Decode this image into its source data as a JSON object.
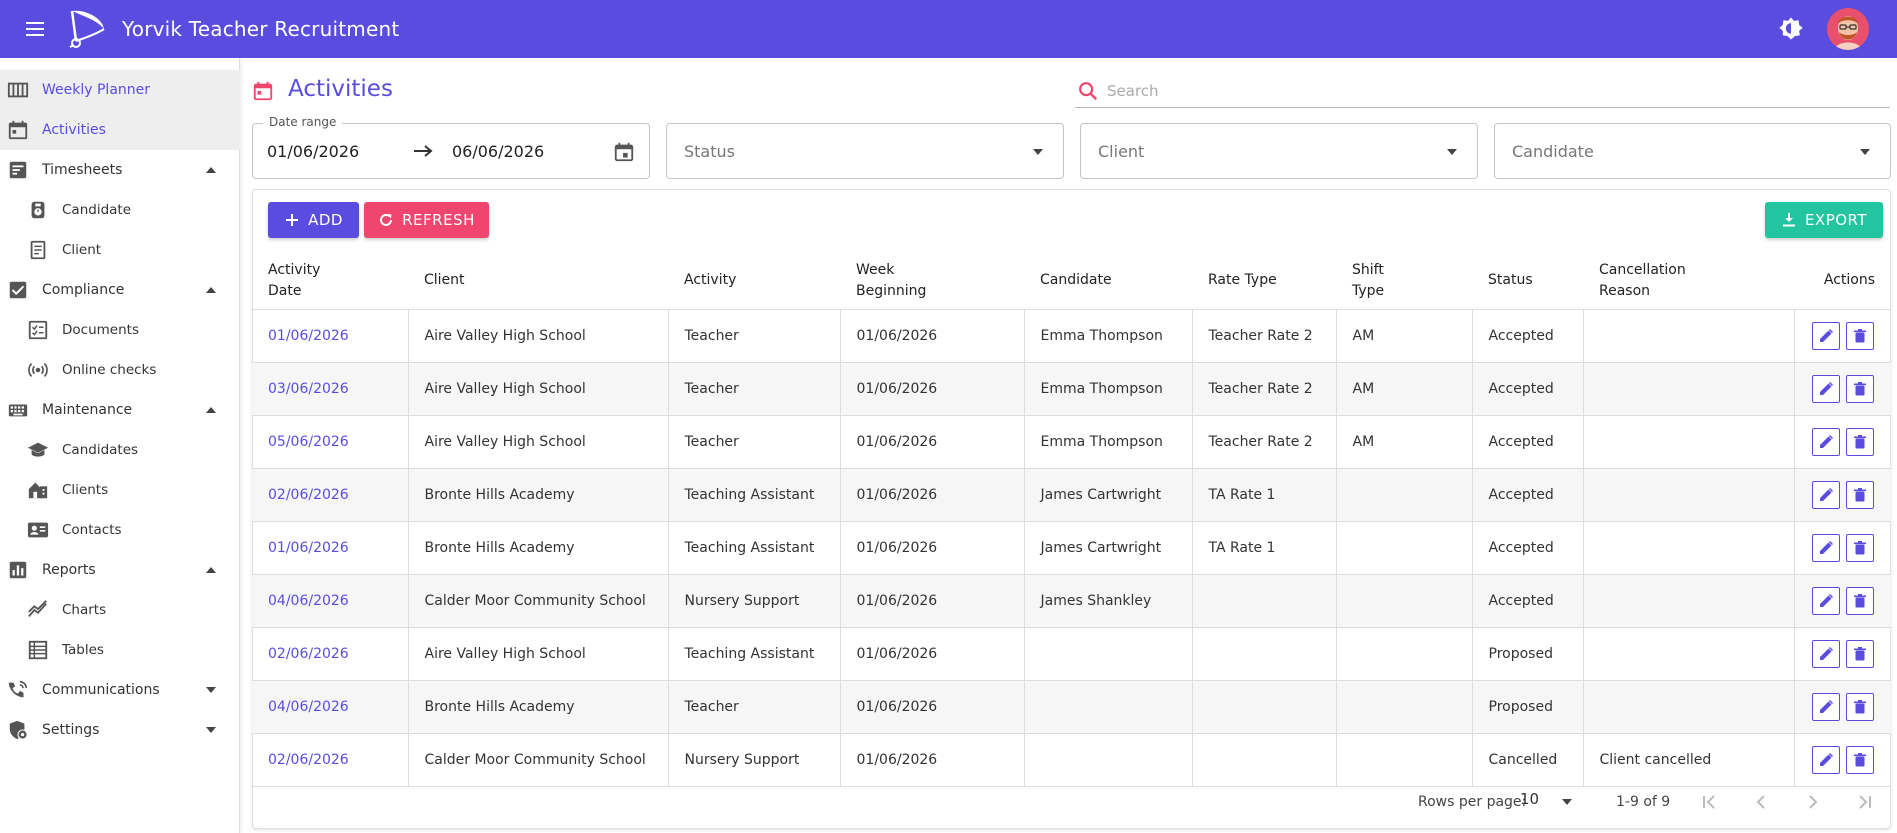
{
  "header": {
    "title": "Yorvik Teacher Recruitment"
  },
  "sidebar": {
    "items": [
      {
        "label": "Weekly Planner",
        "icon": "calendar-week-icon"
      },
      {
        "label": "Activities",
        "icon": "calendar-icon"
      },
      {
        "label": "Timesheets",
        "icon": "timesheet-icon"
      },
      {
        "label": "Candidate",
        "icon": "stopwatch-icon"
      },
      {
        "label": "Client",
        "icon": "book-icon"
      },
      {
        "label": "Compliance",
        "icon": "checkbox-icon"
      },
      {
        "label": "Documents",
        "icon": "checklist-icon"
      },
      {
        "label": "Online checks",
        "icon": "broadcast-icon"
      },
      {
        "label": "Maintenance",
        "icon": "keyboard-icon"
      },
      {
        "label": "Candidates",
        "icon": "graduation-cap-icon"
      },
      {
        "label": "Clients",
        "icon": "building-icon"
      },
      {
        "label": "Contacts",
        "icon": "contact-card-icon"
      },
      {
        "label": "Reports",
        "icon": "bar-chart-icon"
      },
      {
        "label": "Charts",
        "icon": "line-chart-icon"
      },
      {
        "label": "Tables",
        "icon": "table-icon"
      },
      {
        "label": "Communications",
        "icon": "communications-icon"
      },
      {
        "label": "Settings",
        "icon": "shield-gear-icon"
      }
    ]
  },
  "page": {
    "title": "Activities"
  },
  "search": {
    "placeholder": "Search"
  },
  "filters": {
    "date_range_label": "Date range",
    "date_from": "01/06/2026",
    "date_to": "06/06/2026",
    "status_placeholder": "Status",
    "client_placeholder": "Client",
    "candidate_placeholder": "Candidate"
  },
  "toolbar": {
    "add_label": "ADD",
    "refresh_label": "REFRESH",
    "export_label": "EXPORT"
  },
  "table": {
    "headers": {
      "activity_date_1": "Activity",
      "activity_date_2": "Date",
      "client": "Client",
      "activity": "Activity",
      "week_1": "Week",
      "week_2": "Beginning",
      "candidate": "Candidate",
      "rate_type": "Rate Type",
      "shift_1": "Shift",
      "shift_2": "Type",
      "status": "Status",
      "cancel_1": "Cancellation",
      "cancel_2": "Reason",
      "actions": "Actions"
    },
    "rows": [
      {
        "date": "01/06/2026",
        "client": "Aire Valley High School",
        "activity": "Teacher",
        "week": "01/06/2026",
        "candidate": "Emma Thompson",
        "rate": "Teacher Rate 2",
        "shift": "AM",
        "status": "Accepted",
        "reason": ""
      },
      {
        "date": "03/06/2026",
        "client": "Aire Valley High School",
        "activity": "Teacher",
        "week": "01/06/2026",
        "candidate": "Emma Thompson",
        "rate": "Teacher Rate 2",
        "shift": "AM",
        "status": "Accepted",
        "reason": ""
      },
      {
        "date": "05/06/2026",
        "client": "Aire Valley High School",
        "activity": "Teacher",
        "week": "01/06/2026",
        "candidate": "Emma Thompson",
        "rate": "Teacher Rate 2",
        "shift": "AM",
        "status": "Accepted",
        "reason": ""
      },
      {
        "date": "02/06/2026",
        "client": "Bronte Hills Academy",
        "activity": "Teaching Assistant",
        "week": "01/06/2026",
        "candidate": "James Cartwright",
        "rate": "TA Rate 1",
        "shift": "",
        "status": "Accepted",
        "reason": ""
      },
      {
        "date": "01/06/2026",
        "client": "Bronte Hills Academy",
        "activity": "Teaching Assistant",
        "week": "01/06/2026",
        "candidate": "James Cartwright",
        "rate": "TA Rate 1",
        "shift": "",
        "status": "Accepted",
        "reason": ""
      },
      {
        "date": "04/06/2026",
        "client": "Calder Moor Community School",
        "activity": "Nursery Support",
        "week": "01/06/2026",
        "candidate": "James Shankley",
        "rate": "",
        "shift": "",
        "status": "Accepted",
        "reason": ""
      },
      {
        "date": "02/06/2026",
        "client": "Aire Valley High School",
        "activity": "Teaching Assistant",
        "week": "01/06/2026",
        "candidate": "",
        "rate": "",
        "shift": "",
        "status": "Proposed",
        "reason": ""
      },
      {
        "date": "04/06/2026",
        "client": "Bronte Hills Academy",
        "activity": "Teacher",
        "week": "01/06/2026",
        "candidate": "",
        "rate": "",
        "shift": "",
        "status": "Proposed",
        "reason": ""
      },
      {
        "date": "02/06/2026",
        "client": "Calder Moor Community School",
        "activity": "Nursery Support",
        "week": "01/06/2026",
        "candidate": "",
        "rate": "",
        "shift": "",
        "status": "Cancelled",
        "reason": "Client cancelled"
      }
    ]
  },
  "pagination": {
    "rows_per_page_label": "Rows per page:",
    "rows_per_page": "10",
    "range": "1-9 of 9"
  },
  "colors": {
    "primary": "#5b4ce0",
    "accent": "#f0456e",
    "export": "#23c5a0"
  }
}
